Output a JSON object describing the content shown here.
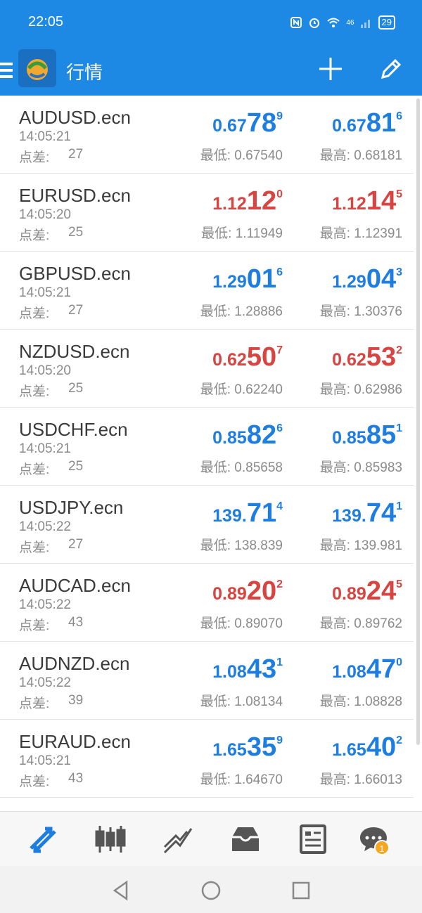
{
  "status_bar": {
    "time": "22:05",
    "network": "46",
    "battery": "29"
  },
  "app_bar": {
    "title": "行情",
    "icons": [
      "menu-icon",
      "metatrader-logo",
      "add-icon",
      "edit-icon"
    ]
  },
  "colors": {
    "primary": "#1e88e5",
    "up": "#1e7ee0",
    "down": "#d64541"
  },
  "quotes": [
    {
      "symbol": "AUDUSD.ecn",
      "time": "14:05:21",
      "spread_label": "点差:",
      "spread": "27",
      "color": "blue",
      "bid": {
        "small": "0.67",
        "big": "78",
        "sup": "9"
      },
      "ask": {
        "small": "0.67",
        "big": "81",
        "sup": "6"
      },
      "low": "最低: 0.67540",
      "high": "最高: 0.68181"
    },
    {
      "symbol": "EURUSD.ecn",
      "time": "14:05:20",
      "spread_label": "点差:",
      "spread": "25",
      "color": "red",
      "bid": {
        "small": "1.12",
        "big": "12",
        "sup": "0"
      },
      "ask": {
        "small": "1.12",
        "big": "14",
        "sup": "5"
      },
      "low": "最低: 1.11949",
      "high": "最高: 1.12391"
    },
    {
      "symbol": "GBPUSD.ecn",
      "time": "14:05:21",
      "spread_label": "点差:",
      "spread": "27",
      "color": "blue",
      "bid": {
        "small": "1.29",
        "big": "01",
        "sup": "6"
      },
      "ask": {
        "small": "1.29",
        "big": "04",
        "sup": "3"
      },
      "low": "最低: 1.28886",
      "high": "最高: 1.30376"
    },
    {
      "symbol": "NZDUSD.ecn",
      "time": "14:05:20",
      "spread_label": "点差:",
      "spread": "25",
      "color": "red",
      "bid": {
        "small": "0.62",
        "big": "50",
        "sup": "7"
      },
      "ask": {
        "small": "0.62",
        "big": "53",
        "sup": "2"
      },
      "low": "最低: 0.62240",
      "high": "最高: 0.62986"
    },
    {
      "symbol": "USDCHF.ecn",
      "time": "14:05:21",
      "spread_label": "点差:",
      "spread": "25",
      "color": "blue",
      "bid": {
        "small": "0.85",
        "big": "82",
        "sup": "6"
      },
      "ask": {
        "small": "0.85",
        "big": "85",
        "sup": "1"
      },
      "low": "最低: 0.85658",
      "high": "最高: 0.85983"
    },
    {
      "symbol": "USDJPY.ecn",
      "time": "14:05:22",
      "spread_label": "点差:",
      "spread": "27",
      "color": "blue",
      "bid": {
        "small": "139.",
        "big": "71",
        "sup": "4"
      },
      "ask": {
        "small": "139.",
        "big": "74",
        "sup": "1"
      },
      "low": "最低: 138.839",
      "high": "最高: 139.981"
    },
    {
      "symbol": "AUDCAD.ecn",
      "time": "14:05:22",
      "spread_label": "点差:",
      "spread": "43",
      "color": "red",
      "bid": {
        "small": "0.89",
        "big": "20",
        "sup": "2"
      },
      "ask": {
        "small": "0.89",
        "big": "24",
        "sup": "5"
      },
      "low": "最低: 0.89070",
      "high": "最高: 0.89762"
    },
    {
      "symbol": "AUDNZD.ecn",
      "time": "14:05:22",
      "spread_label": "点差:",
      "spread": "39",
      "color": "blue",
      "bid": {
        "small": "1.08",
        "big": "43",
        "sup": "1"
      },
      "ask": {
        "small": "1.08",
        "big": "47",
        "sup": "0"
      },
      "low": "最低: 1.08134",
      "high": "最高: 1.08828"
    },
    {
      "symbol": "EURAUD.ecn",
      "time": "14:05:21",
      "spread_label": "点差:",
      "spread": "43",
      "color": "blue",
      "bid": {
        "small": "1.65",
        "big": "35",
        "sup": "9"
      },
      "ask": {
        "small": "1.65",
        "big": "40",
        "sup": "2"
      },
      "low": "最低: 1.64670",
      "high": "最高: 1.66013"
    }
  ],
  "bottom_nav": {
    "items": [
      "quotes-icon",
      "chart-icon",
      "trade-icon",
      "history-icon",
      "news-icon",
      "chat-icon"
    ],
    "chat_badge": "1"
  },
  "system_nav": [
    "back-icon",
    "home-icon",
    "recents-icon"
  ]
}
